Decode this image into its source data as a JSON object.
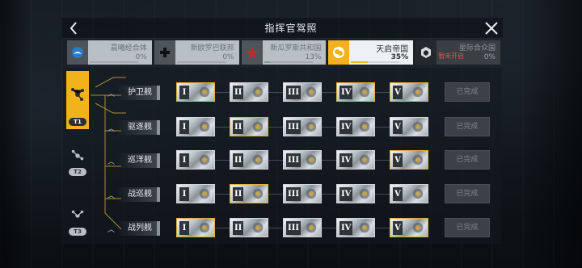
{
  "header": {
    "title": "指挥官驾照",
    "back_icon": "chevron-left-icon",
    "close_icon": "close-icon"
  },
  "tabs": [
    {
      "name": "晨曦经合体",
      "pct": "0%",
      "progress": 0.0,
      "state": "normal",
      "icon": "circle-orb-icon",
      "lock_text": ""
    },
    {
      "name": "新欧罗巴联邦",
      "pct": "0%",
      "progress": 0.0,
      "state": "normal",
      "icon": "cross-icon",
      "lock_text": ""
    },
    {
      "name": "新瓜罗斯共和国",
      "pct": "13%",
      "progress": 0.13,
      "state": "normal",
      "icon": "star-emblem-icon",
      "lock_text": ""
    },
    {
      "name": "天启帝国",
      "pct": "35%",
      "progress": 0.35,
      "state": "active",
      "icon": "empire-emblem-icon",
      "lock_text": ""
    },
    {
      "name": "星际合众国",
      "pct": "0%",
      "progress": 0.0,
      "state": "locked",
      "icon": "hex-emblem-icon",
      "lock_text": "暂未开启"
    }
  ],
  "tiers": [
    {
      "badge": "T1",
      "selected": true,
      "icon": "ship-tier-icon"
    },
    {
      "badge": "T2",
      "selected": false,
      "icon": "ship-tier-icon"
    },
    {
      "badge": "T3",
      "selected": false,
      "icon": "ship-tier-icon"
    }
  ],
  "rows": [
    {
      "label": "护卫舰",
      "levels": [
        "I",
        "II",
        "III",
        "IV",
        "V"
      ],
      "done_label": "已完成"
    },
    {
      "label": "驱逐舰",
      "levels": [
        "I",
        "II",
        "III",
        "IV",
        "V"
      ],
      "done_label": "已完成"
    },
    {
      "label": "巡洋舰",
      "levels": [
        "I",
        "II",
        "III",
        "IV",
        "V"
      ],
      "done_label": "已完成"
    },
    {
      "label": "战巡舰",
      "levels": [
        "I",
        "II",
        "III",
        "IV",
        "V"
      ],
      "done_label": "已完成"
    },
    {
      "label": "战列舰",
      "levels": [
        "I",
        "II",
        "III",
        "IV",
        "V"
      ],
      "done_label": "已完成"
    }
  ],
  "colors": {
    "accent": "#f2b21c",
    "star_red": "#c8282d",
    "lock_red": "#e05050"
  }
}
